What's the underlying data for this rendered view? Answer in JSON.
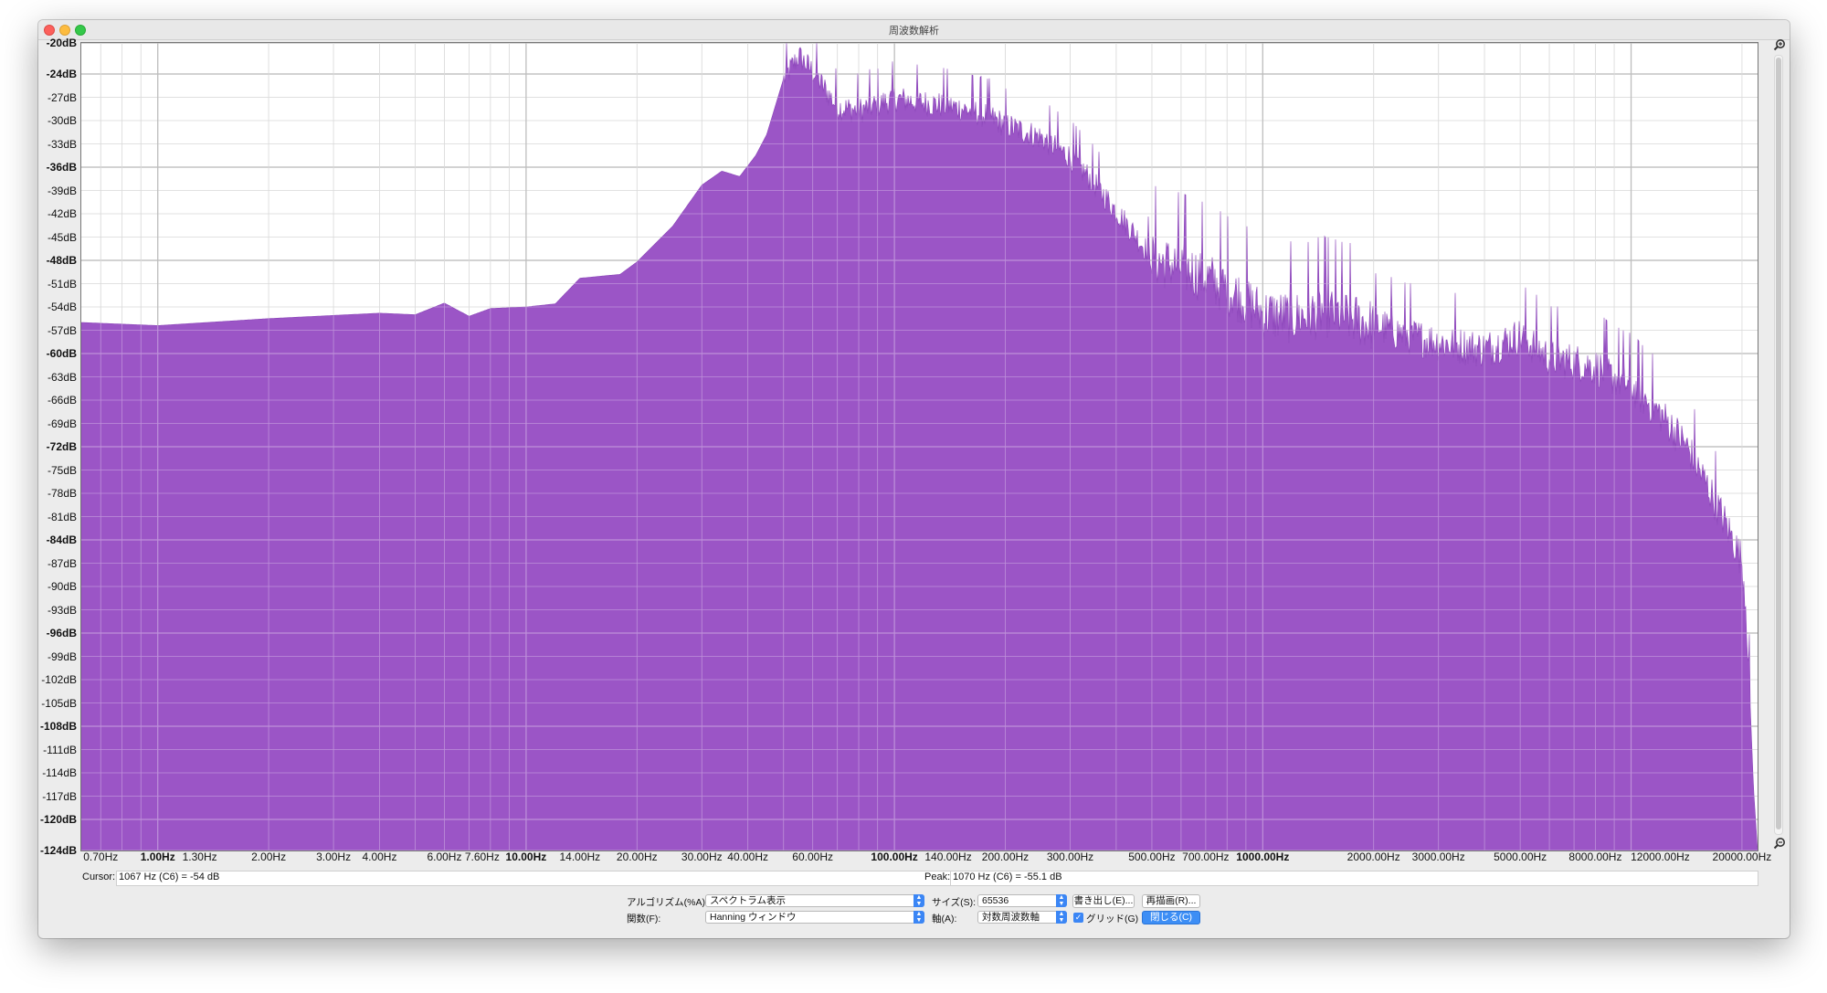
{
  "window": {
    "title": "周波数解析"
  },
  "colors": {
    "spectrum": "#9b55c6",
    "grid": "#c8c8c8",
    "accent": "#3b86f5"
  },
  "chart_data": {
    "type": "area",
    "title": "",
    "xlabel": "",
    "ylabel": "",
    "x_scale": "log",
    "xlim_hz": [
      0.62,
      22050
    ],
    "ylim": [
      -124,
      -20
    ],
    "grid": true,
    "y_ticks": [
      {
        "label": "-20dB",
        "major": true
      },
      {
        "label": "-24dB",
        "major": true
      },
      {
        "label": "-27dB",
        "major": false
      },
      {
        "label": "-30dB",
        "major": false
      },
      {
        "label": "-33dB",
        "major": false
      },
      {
        "label": "-36dB",
        "major": true
      },
      {
        "label": "-39dB",
        "major": false
      },
      {
        "label": "-42dB",
        "major": false
      },
      {
        "label": "-45dB",
        "major": false
      },
      {
        "label": "-48dB",
        "major": true
      },
      {
        "label": "-51dB",
        "major": false
      },
      {
        "label": "-54dB",
        "major": false
      },
      {
        "label": "-57dB",
        "major": false
      },
      {
        "label": "-60dB",
        "major": true
      },
      {
        "label": "-63dB",
        "major": false
      },
      {
        "label": "-66dB",
        "major": false
      },
      {
        "label": "-69dB",
        "major": false
      },
      {
        "label": "-72dB",
        "major": true
      },
      {
        "label": "-75dB",
        "major": false
      },
      {
        "label": "-78dB",
        "major": false
      },
      {
        "label": "-81dB",
        "major": false
      },
      {
        "label": "-84dB",
        "major": true
      },
      {
        "label": "-87dB",
        "major": false
      },
      {
        "label": "-90dB",
        "major": false
      },
      {
        "label": "-93dB",
        "major": false
      },
      {
        "label": "-96dB",
        "major": true
      },
      {
        "label": "-99dB",
        "major": false
      },
      {
        "label": "-102dB",
        "major": false
      },
      {
        "label": "-105dB",
        "major": false
      },
      {
        "label": "-108dB",
        "major": true
      },
      {
        "label": "-111dB",
        "major": false
      },
      {
        "label": "-114dB",
        "major": false
      },
      {
        "label": "-117dB",
        "major": false
      },
      {
        "label": "-120dB",
        "major": true
      },
      {
        "label": "-124dB",
        "major": true
      }
    ],
    "y_tick_values": [
      -20,
      -24,
      -27,
      -30,
      -33,
      -36,
      -39,
      -42,
      -45,
      -48,
      -51,
      -54,
      -57,
      -60,
      -63,
      -66,
      -69,
      -72,
      -75,
      -78,
      -81,
      -84,
      -87,
      -90,
      -93,
      -96,
      -99,
      -102,
      -105,
      -108,
      -111,
      -114,
      -117,
      -120,
      -124
    ],
    "x_ticks": [
      {
        "label": "0.70Hz",
        "hz": 0.7,
        "major": false
      },
      {
        "label": "1.00Hz",
        "hz": 1,
        "major": true
      },
      {
        "label": "1.30Hz",
        "hz": 1.3,
        "major": false
      },
      {
        "label": "2.00Hz",
        "hz": 2,
        "major": false
      },
      {
        "label": "3.00Hz",
        "hz": 3,
        "major": false
      },
      {
        "label": "4.00Hz",
        "hz": 4,
        "major": false
      },
      {
        "label": "6.00Hz",
        "hz": 6,
        "major": false
      },
      {
        "label": "7.60Hz",
        "hz": 7.6,
        "major": false
      },
      {
        "label": "10.00Hz",
        "hz": 10,
        "major": true
      },
      {
        "label": "14.00Hz",
        "hz": 14,
        "major": false
      },
      {
        "label": "20.00Hz",
        "hz": 20,
        "major": false
      },
      {
        "label": "30.00Hz",
        "hz": 30,
        "major": false
      },
      {
        "label": "40.00Hz",
        "hz": 40,
        "major": false
      },
      {
        "label": "60.00Hz",
        "hz": 60,
        "major": false
      },
      {
        "label": "100.00Hz",
        "hz": 100,
        "major": true
      },
      {
        "label": "140.00Hz",
        "hz": 140,
        "major": false
      },
      {
        "label": "200.00Hz",
        "hz": 200,
        "major": false
      },
      {
        "label": "300.00Hz",
        "hz": 300,
        "major": false
      },
      {
        "label": "500.00Hz",
        "hz": 500,
        "major": false
      },
      {
        "label": "700.00Hz",
        "hz": 700,
        "major": false
      },
      {
        "label": "1000.00Hz",
        "hz": 1000,
        "major": true
      },
      {
        "label": "2000.00Hz",
        "hz": 2000,
        "major": false
      },
      {
        "label": "3000.00Hz",
        "hz": 3000,
        "major": false
      },
      {
        "label": "5000.00Hz",
        "hz": 5000,
        "major": false
      },
      {
        "label": "8000.00Hz",
        "hz": 8000,
        "major": false
      },
      {
        "label": "12000.00Hz",
        "hz": 12000,
        "major": false
      },
      {
        "label": "20000.00Hz",
        "hz": 20000,
        "major": false
      }
    ],
    "series": [
      {
        "x_hz": [
          0.62,
          1,
          2,
          4,
          5,
          6,
          7,
          8,
          10,
          12,
          14,
          18,
          20,
          25,
          30,
          34,
          38,
          42,
          45,
          50,
          55,
          60,
          70,
          80,
          90,
          100,
          120,
          150,
          180,
          200,
          250,
          300,
          350,
          400,
          450,
          500,
          600,
          700,
          800,
          900,
          1000,
          1200,
          1500,
          2000,
          2500,
          3000,
          4000,
          5000,
          6000,
          7000,
          8000,
          10000,
          12000,
          14000,
          16000,
          18000,
          19000,
          20000,
          20500,
          21000,
          21500,
          22050
        ],
        "y_db": [
          -56,
          -56.4,
          -55.5,
          -54.8,
          -55.0,
          -53.5,
          -55.2,
          -54.2,
          -54,
          -53.6,
          -50.3,
          -49.8,
          -48.2,
          -43.6,
          -38.3,
          -36.5,
          -37.2,
          -34.5,
          -31.8,
          -24.6,
          -21.5,
          -23.5,
          -28.1,
          -28.5,
          -27.8,
          -27.0,
          -27.5,
          -28.2,
          -29.2,
          -30.4,
          -32.0,
          -34.5,
          -38.0,
          -41.5,
          -44.5,
          -47.5,
          -48.5,
          -49.8,
          -51.3,
          -52.8,
          -54.5,
          -55.0,
          -54.2,
          -56.0,
          -57.5,
          -58.3,
          -59.2,
          -57.5,
          -60.3,
          -60.8,
          -61.5,
          -64.0,
          -67.5,
          -71.3,
          -76.5,
          -81.5,
          -84.0,
          -86.5,
          -92.0,
          -104.0,
          -116.0,
          -124.0
        ]
      }
    ]
  },
  "readouts": {
    "cursor_label": "Cursor:",
    "cursor_value": "1067 Hz (C6) = -54 dB",
    "peak_label": "Peak:",
    "peak_value": "1070 Hz (C6) = -55.1 dB"
  },
  "controls": {
    "algorithm_label": "アルゴリズム(%A):",
    "algorithm_value": "スペクトラム表示",
    "function_label": "関数(F):",
    "function_value": "Hanning ウィンドウ",
    "size_label": "サイズ(S):",
    "size_value": "65536",
    "axis_label": "軸(A):",
    "axis_value": "対数周波数軸",
    "export_button": "書き出し(E)...",
    "replot_button": "再描画(R)...",
    "grid_label": "グリッド(G)",
    "grid_checked": true,
    "close_button": "閉じる(C)"
  }
}
